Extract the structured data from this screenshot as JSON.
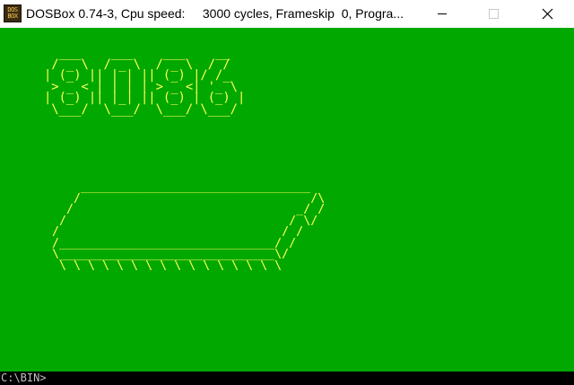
{
  "window": {
    "app_icon_text": [
      "DOS",
      "BOX"
    ],
    "title": "DOSBox 0.74-3, Cpu speed:     3000 cycles, Frameskip  0, Progra...",
    "controls": [
      "minimize-icon",
      "maximize-icon",
      "close-icon"
    ]
  },
  "screen": {
    "background_color": "#00a800",
    "text_color": "#ffff55",
    "logo_ascii": "  ___    ___    ___    __\n / _ \\  / _ \\  / _ \\  / /\n| (_) || | | || (_) |/ /_\n > _ < | | | | > _ <| '_ \\\n| (_) || |_| || (_) | (_) |\n \\___/  \\___/  \\___/ \\___/",
    "chip_ascii": "    ________________________________\n   /                                /\\\n  /                               _/ /\n /                               / \\/\n/                               / /\n/______________________________/ /\n\\______________________________\\/\n \\ \\ \\ \\ \\ \\ \\ \\ \\ \\ \\ \\ \\ \\ \\ \\"
  },
  "prompt": {
    "text": "C:\\BIN>"
  }
}
